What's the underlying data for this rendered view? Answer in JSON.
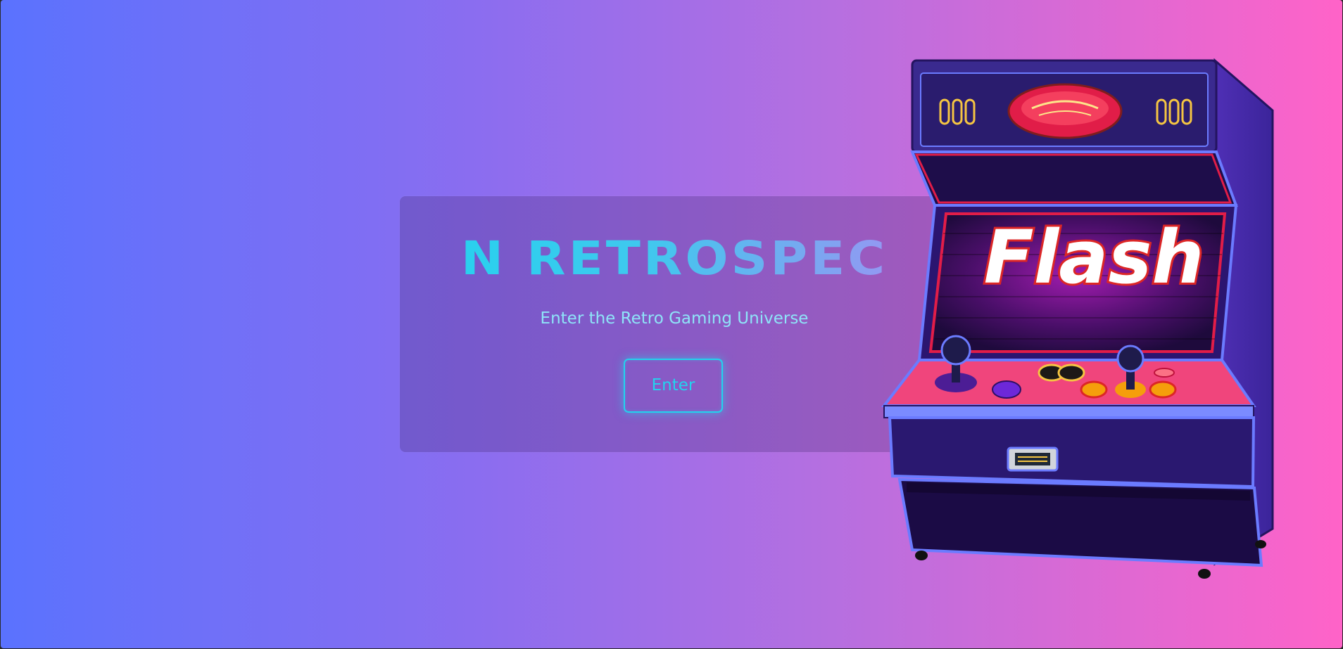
{
  "hero": {
    "title": "N RETROSPEC",
    "subtitle": "Enter the Retro Gaming Universe",
    "enter_label": "Enter"
  },
  "arcade": {
    "screen_text": "Flash"
  },
  "colors": {
    "accent": "#22d3ee",
    "background_start": "#5a72fe",
    "background_end": "#ff63c8"
  }
}
